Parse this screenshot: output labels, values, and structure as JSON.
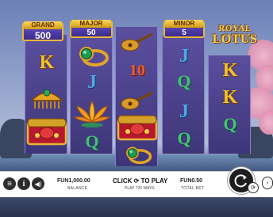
{
  "game": {
    "logo": {
      "line1": "ROYAL",
      "line2": "LOTUS"
    },
    "jackpots": [
      {
        "label": "GRAND",
        "value": "500"
      },
      {
        "label": "MAJOR",
        "value": "50"
      },
      {
        "label": "MINOR",
        "value": "5"
      }
    ],
    "reels": [
      {
        "symbols": [
          "letter-K",
          "treasure-comb",
          "treasure-chest"
        ],
        "texts": [
          "K"
        ]
      },
      {
        "symbols": [
          "emerald-ring",
          "letter-J",
          "golden-lotus",
          "letter-Q"
        ],
        "texts": [
          "J",
          "Q"
        ]
      },
      {
        "symbols": [
          "pipa-lute",
          "10",
          "pipa-lute",
          "treasure-chest",
          "emerald-ring"
        ],
        "texts": [
          "10"
        ]
      },
      {
        "symbols": [
          "letter-J",
          "letter-Q",
          "letter-J",
          "letter-Q"
        ],
        "texts": [
          "J",
          "Q",
          "J",
          "Q"
        ]
      },
      {
        "symbols": [
          "letter-K",
          "letter-K",
          "letter-Q"
        ],
        "texts": [
          "K",
          "K",
          "Q"
        ]
      }
    ]
  },
  "bottom_bar": {
    "balance_value": "FUN1,000.00",
    "balance_label": "BALANCE",
    "cta_text": "CLICK ⟳ TO PLAY",
    "ways_text": "PLAY 720 WAYS",
    "bet_value": "FUN0.50",
    "bet_label": "TOTAL BET"
  },
  "colors": {
    "reel": "#4b4190",
    "gold": "#f2c230",
    "frame": "#e8b53a"
  }
}
